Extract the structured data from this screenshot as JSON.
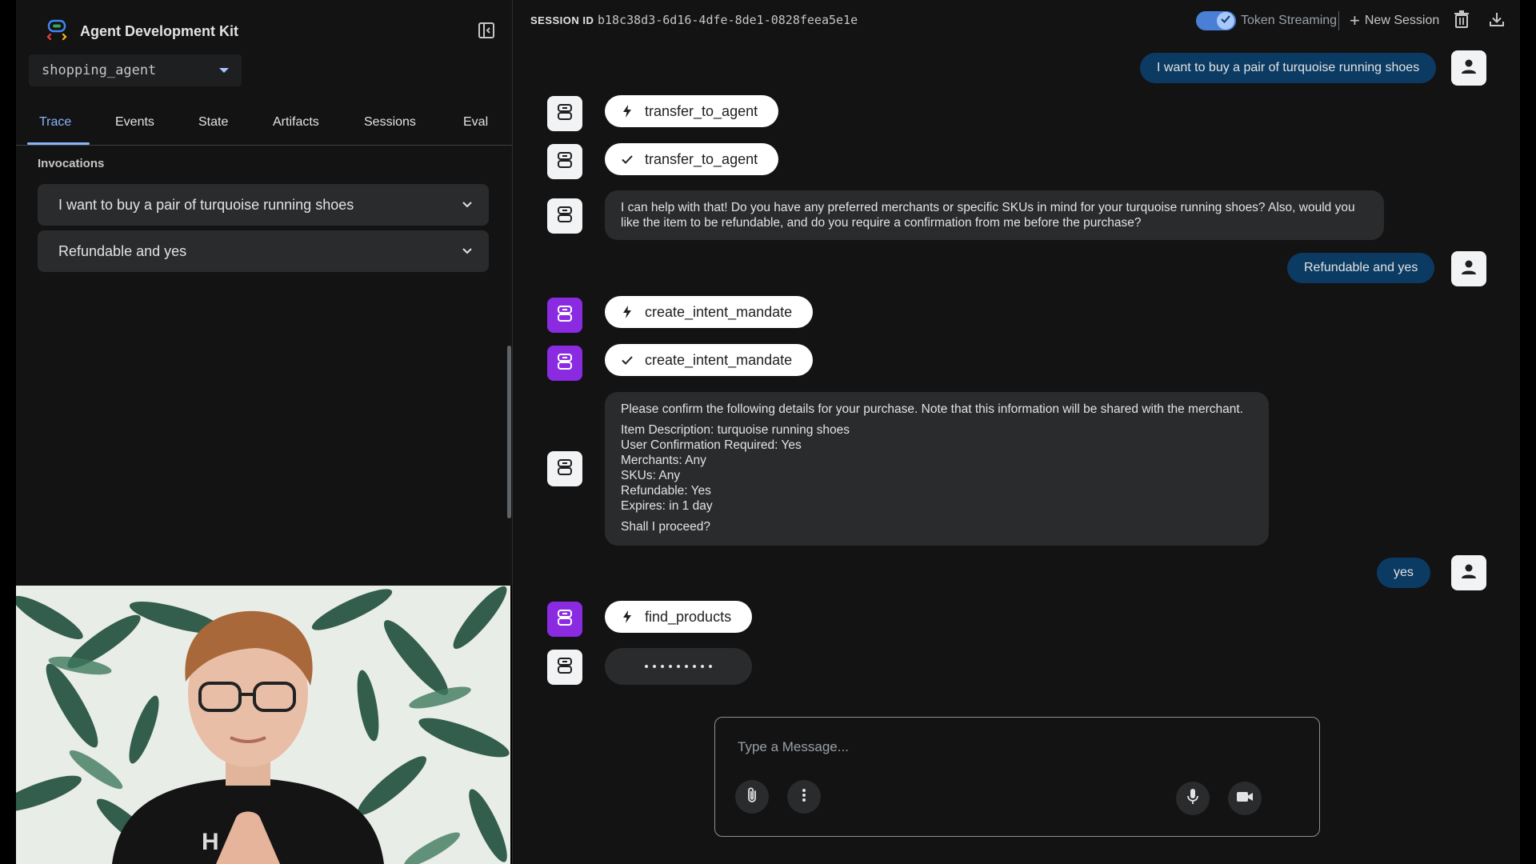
{
  "app": {
    "title": "Agent Development Kit"
  },
  "sidebar": {
    "agent": "shopping_agent",
    "tabs": [
      {
        "label": "Trace",
        "active": true
      },
      {
        "label": "Events"
      },
      {
        "label": "State"
      },
      {
        "label": "Artifacts"
      },
      {
        "label": "Sessions"
      },
      {
        "label": "Eval"
      }
    ],
    "section_label": "Invocations",
    "invocations": [
      "I want to buy a pair of turquoise running shoes",
      "Refundable and yes"
    ]
  },
  "header": {
    "session_label": "SESSION ID",
    "session_id": "b18c38d3-6d16-4dfe-8de1-0828feea5e1e",
    "token_streaming_label": "Token Streaming",
    "token_streaming_on": true,
    "new_session_label": "New Session"
  },
  "chat": {
    "user_1": "I want to buy a pair of turquoise running shoes",
    "call_1": "transfer_to_agent",
    "result_1": "transfer_to_agent",
    "bot_1": "I can help with that! Do you have any preferred merchants or specific SKUs in mind for your turquoise running shoes? Also, would you like the item to be refundable, and do you require a confirmation from me before the purchase?",
    "user_2": "Refundable and yes",
    "call_2": "create_intent_mandate",
    "result_2": "create_intent_mandate",
    "confirm": {
      "intro": "Please confirm the following details for your purchase. Note that this information will be shared with the merchant.",
      "lines": [
        "Item Description: turquoise running shoes",
        "User Confirmation Required: Yes",
        "Merchants: Any",
        "SKUs: Any",
        "Refundable: Yes",
        "Expires: in 1 day"
      ],
      "question": "Shall I proceed?"
    },
    "user_3": "yes",
    "call_3": "find_products"
  },
  "composer": {
    "placeholder": "Type a Message..."
  },
  "colors": {
    "accent": "#8ab4f8",
    "user_bubble": "#0b3b63",
    "bot_bubble": "#2a2b2d",
    "agent_purple": "#8a2be2"
  },
  "icons": [
    "adk-logo-icon",
    "side-panel-icon",
    "dropdown-caret-icon",
    "chevron-down-icon",
    "check-icon",
    "plus-icon",
    "trash-icon",
    "download-icon",
    "bot-icon",
    "bolt-icon",
    "user-icon",
    "attach-icon",
    "more-vert-icon",
    "mic-icon",
    "videocam-icon"
  ]
}
